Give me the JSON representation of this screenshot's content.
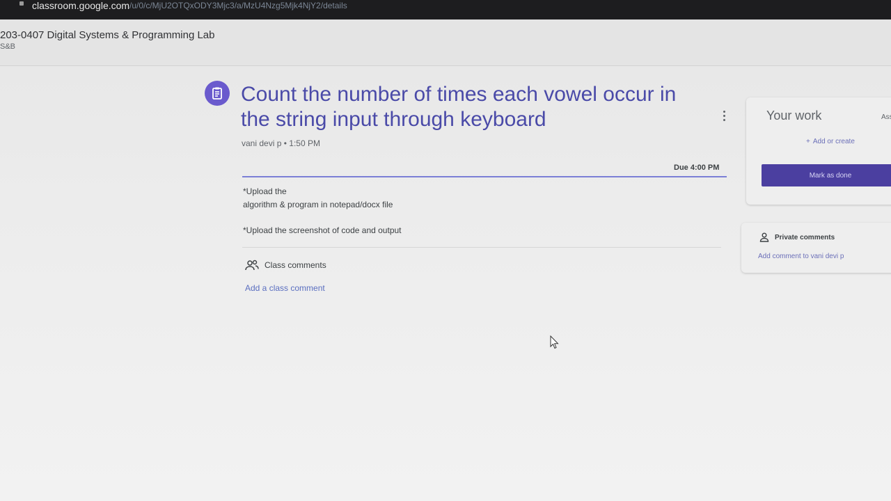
{
  "browser": {
    "url_host": "classroom.google.com",
    "url_path": "/u/0/c/MjU2OTQxODY3Mjc3/a/MzU4Nzg5Mjk4NjY2/details"
  },
  "course": {
    "title": "203-0407 Digital Systems & Programming Lab",
    "section": "S&B"
  },
  "assignment": {
    "icon": "assignment-icon",
    "title": "Count the number of times each vowel occur in the string input through keyboard",
    "author": "vani devi p",
    "separator": "•",
    "time": "1:50 PM",
    "due": "Due 4:00 PM",
    "description": [
      "*Upload the",
      "algorithm & program  in notepad/docx file",
      "*Upload the  screenshot of code and output"
    ]
  },
  "class_comments": {
    "label": "Class comments",
    "add_label": "Add a class comment",
    "icon": "people-icon"
  },
  "your_work": {
    "title": "Your work",
    "status": "Assigned",
    "add_label": "Add or create",
    "mark_done_label": "Mark as done"
  },
  "private_comments": {
    "title": "Private comments",
    "add_label": "Add comment to vani devi p",
    "icon": "person-icon"
  },
  "colors": {
    "accent": "#4b3fa0",
    "title": "#4a4aa8",
    "link": "#5b6fc0"
  }
}
